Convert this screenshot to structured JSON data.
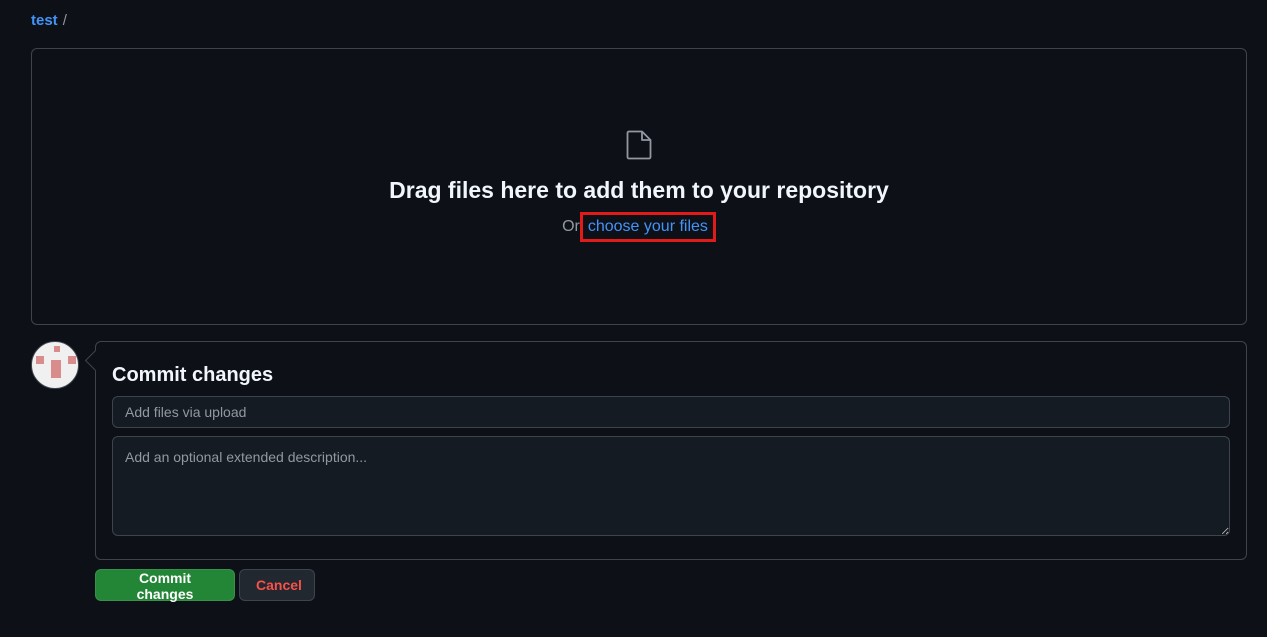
{
  "breadcrumb": {
    "repo": "test",
    "separator": "/"
  },
  "dropzone": {
    "icon": "file-icon",
    "title": "Drag files here to add them to your repository",
    "prefix": "Or",
    "choose_link": "choose your files"
  },
  "commit": {
    "title": "Commit changes",
    "summary_placeholder": "Add files via upload",
    "description_placeholder": "Add an optional extended description...",
    "commit_button": "Commit changes",
    "cancel_button": "Cancel"
  },
  "colors": {
    "background": "#0d1117",
    "link": "#4493f8",
    "primary_button": "#238636",
    "danger_text": "#f85149",
    "highlight_box": "#e11a1a"
  }
}
